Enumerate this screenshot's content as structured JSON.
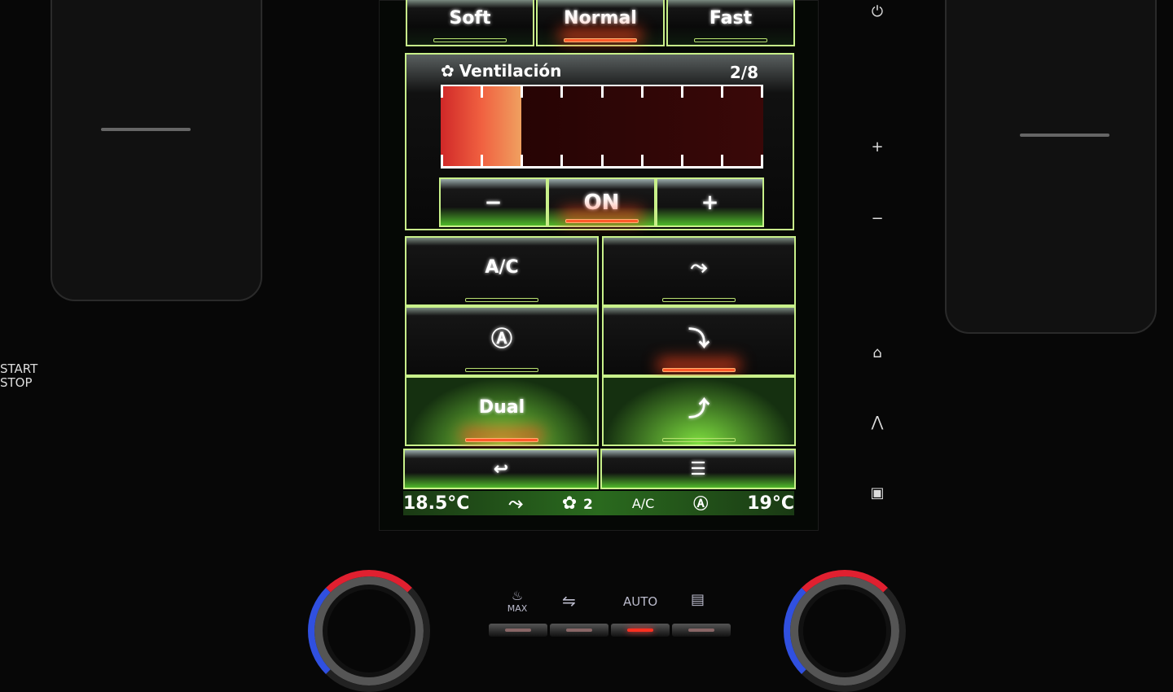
{
  "hardware_left": {
    "start_stop": [
      "START",
      "STOP"
    ]
  },
  "mode_buttons": [
    {
      "label": "Soft",
      "active": false
    },
    {
      "label": "Normal",
      "active": true
    },
    {
      "label": "Fast",
      "active": false
    }
  ],
  "ventilation": {
    "icon": "fan-icon",
    "title": "Ventilación",
    "level_text": "2/8",
    "level": 2,
    "max": 8,
    "controls": [
      {
        "label": "−",
        "icon": "minus-icon"
      },
      {
        "label": "ON",
        "active": true
      },
      {
        "label": "+",
        "icon": "plus-icon"
      }
    ]
  },
  "grid": [
    {
      "label": "A/C",
      "active": false
    },
    {
      "icon": "airflow-face-icon",
      "active": false
    },
    {
      "icon": "recirculation-auto-icon",
      "active": false
    },
    {
      "icon": "airflow-feet-icon",
      "active": true
    },
    {
      "label": "Dual",
      "active": true
    },
    {
      "icon": "airflow-windshield-icon",
      "active": false
    }
  ],
  "bottom_buttons": [
    {
      "icon": "back-icon"
    },
    {
      "icon": "menu-list-icon"
    }
  ],
  "status_bar": {
    "left_temp": "18.5°C",
    "airflow_icon": "airflow-icon",
    "fan_icon": "fan-icon",
    "fan_level": "2",
    "ac": "A/C",
    "recirc_icon": "recirculation-auto-icon",
    "right_temp": "19°C"
  },
  "side_buttons": [
    {
      "icon": "power-icon",
      "glyph": "⏻"
    },
    {
      "icon": "volume-up-icon",
      "glyph": "+"
    },
    {
      "icon": "volume-down-icon",
      "glyph": "−"
    },
    {
      "icon": "home-icon",
      "glyph": "⌂"
    },
    {
      "icon": "navigation-icon",
      "glyph": "⋀"
    },
    {
      "icon": "screen-icon",
      "glyph": "▣"
    }
  ],
  "climate_panel": {
    "max_label": "MAX",
    "auto_label": "AUTO",
    "active_button": "AUTO"
  },
  "colors": {
    "accent": "#c8f08a",
    "active": "#ff5a2a",
    "fill": "#e8402a"
  }
}
